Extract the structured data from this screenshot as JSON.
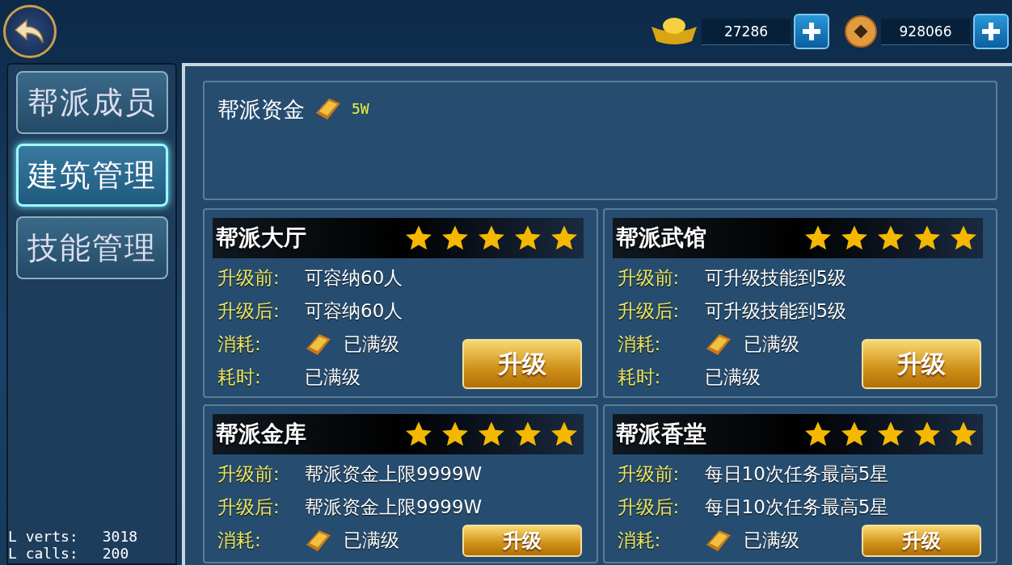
{
  "top_bar": {
    "currencies": [
      {
        "kind": "ingot",
        "amount": "27286"
      },
      {
        "kind": "coin",
        "amount": "928066"
      }
    ]
  },
  "sidebar": {
    "tabs": [
      {
        "label": "帮派成员",
        "selected": false
      },
      {
        "label": "建筑管理",
        "selected": true
      },
      {
        "label": "技能管理",
        "selected": false
      }
    ]
  },
  "fund": {
    "label": "帮派资金",
    "amount": "5W"
  },
  "buildings": [
    {
      "name": "帮派大厅",
      "stars": 5,
      "rows": [
        {
          "label": "升级前:",
          "value": "可容纳60人",
          "icon": false
        },
        {
          "label": "升级后:",
          "value": "可容纳60人",
          "icon": false
        },
        {
          "label": "消耗:",
          "value": "已满级",
          "icon": true
        },
        {
          "label": "耗时:",
          "value": "已满级",
          "icon": false
        }
      ],
      "button": "升级"
    },
    {
      "name": "帮派武馆",
      "stars": 5,
      "rows": [
        {
          "label": "升级前:",
          "value": "可升级技能到5级",
          "icon": false
        },
        {
          "label": "升级后:",
          "value": "可升级技能到5级",
          "icon": false
        },
        {
          "label": "消耗:",
          "value": "已满级",
          "icon": true
        },
        {
          "label": "耗时:",
          "value": "已满级",
          "icon": false
        }
      ],
      "button": "升级"
    },
    {
      "name": "帮派金库",
      "stars": 5,
      "rows": [
        {
          "label": "升级前:",
          "value": "帮派资金上限9999W",
          "icon": false
        },
        {
          "label": "升级后:",
          "value": "帮派资金上限9999W",
          "icon": false
        },
        {
          "label": "消耗:",
          "value": "已满级",
          "icon": true
        }
      ],
      "button": "升级"
    },
    {
      "name": "帮派香堂",
      "stars": 5,
      "rows": [
        {
          "label": "升级前:",
          "value": "每日10次任务最高5星",
          "icon": false
        },
        {
          "label": "升级后:",
          "value": "每日10次任务最高5星",
          "icon": false
        },
        {
          "label": "消耗:",
          "value": "已满级",
          "icon": true
        }
      ],
      "button": "升级"
    }
  ],
  "debug": [
    {
      "label": "L verts:",
      "value": "3018"
    },
    {
      "label": "L calls:",
      "value": "200"
    }
  ]
}
